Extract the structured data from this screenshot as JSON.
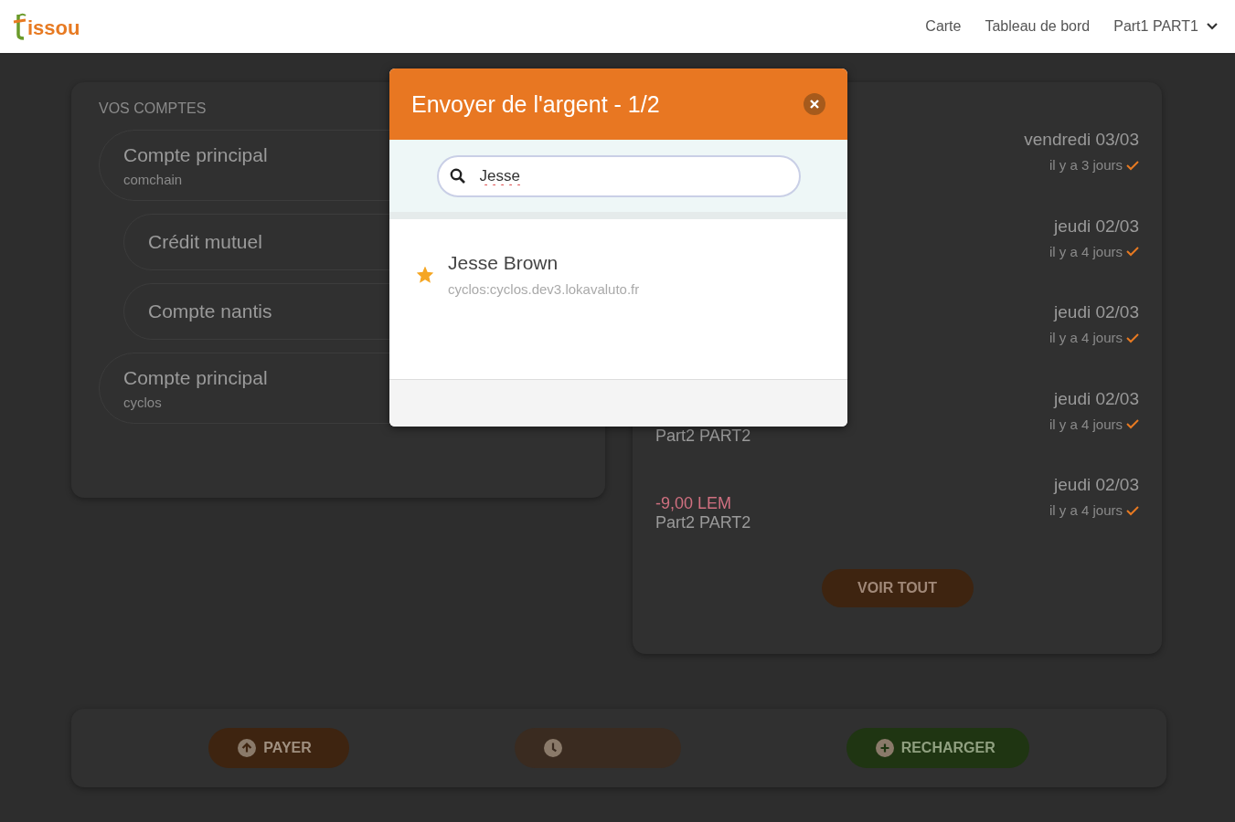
{
  "header": {
    "logo_text": "issou",
    "nav": [
      {
        "label": "Carte"
      },
      {
        "label": "Tableau de bord"
      }
    ],
    "user_menu": "Part1 PART1"
  },
  "accounts": {
    "title": "VOS COMPTES",
    "items": [
      {
        "name": "Compte principal",
        "sub": "comchain",
        "children": [
          {
            "name": "Crédit mutuel"
          },
          {
            "name": "Compte nantis"
          }
        ]
      },
      {
        "name": "Compte principal",
        "sub": "cyclos"
      }
    ]
  },
  "transactions": {
    "items": [
      {
        "date": "vendredi 03/03",
        "ago": "il y a 3 jours"
      },
      {
        "date": "jeudi 02/03",
        "ago": "il y a 4 jours"
      },
      {
        "date": "jeudi 02/03",
        "ago": "il y a 4 jours"
      },
      {
        "counterpart": "Part2 PART2",
        "date": "jeudi 02/03",
        "ago": "il y a 4 jours"
      },
      {
        "amount": "-9,00 LEM",
        "counterpart": "Part2 PART2",
        "date": "jeudi 02/03",
        "ago": "il y a 4 jours"
      }
    ],
    "more_button": "VOIR TOUT"
  },
  "actions": [
    {
      "kind": "pay",
      "label": "PAYER"
    },
    {
      "kind": "transfer"
    },
    {
      "kind": "recharge",
      "label": "RECHARGER"
    }
  ],
  "modal": {
    "title": "Envoyer de l'argent - 1/2",
    "search": {
      "value": "Jesse"
    },
    "results": [
      {
        "name": "Jesse Brown",
        "address": "cyclos:cyclos.dev3.lokavaluto.fr",
        "favorite": true
      }
    ]
  }
}
